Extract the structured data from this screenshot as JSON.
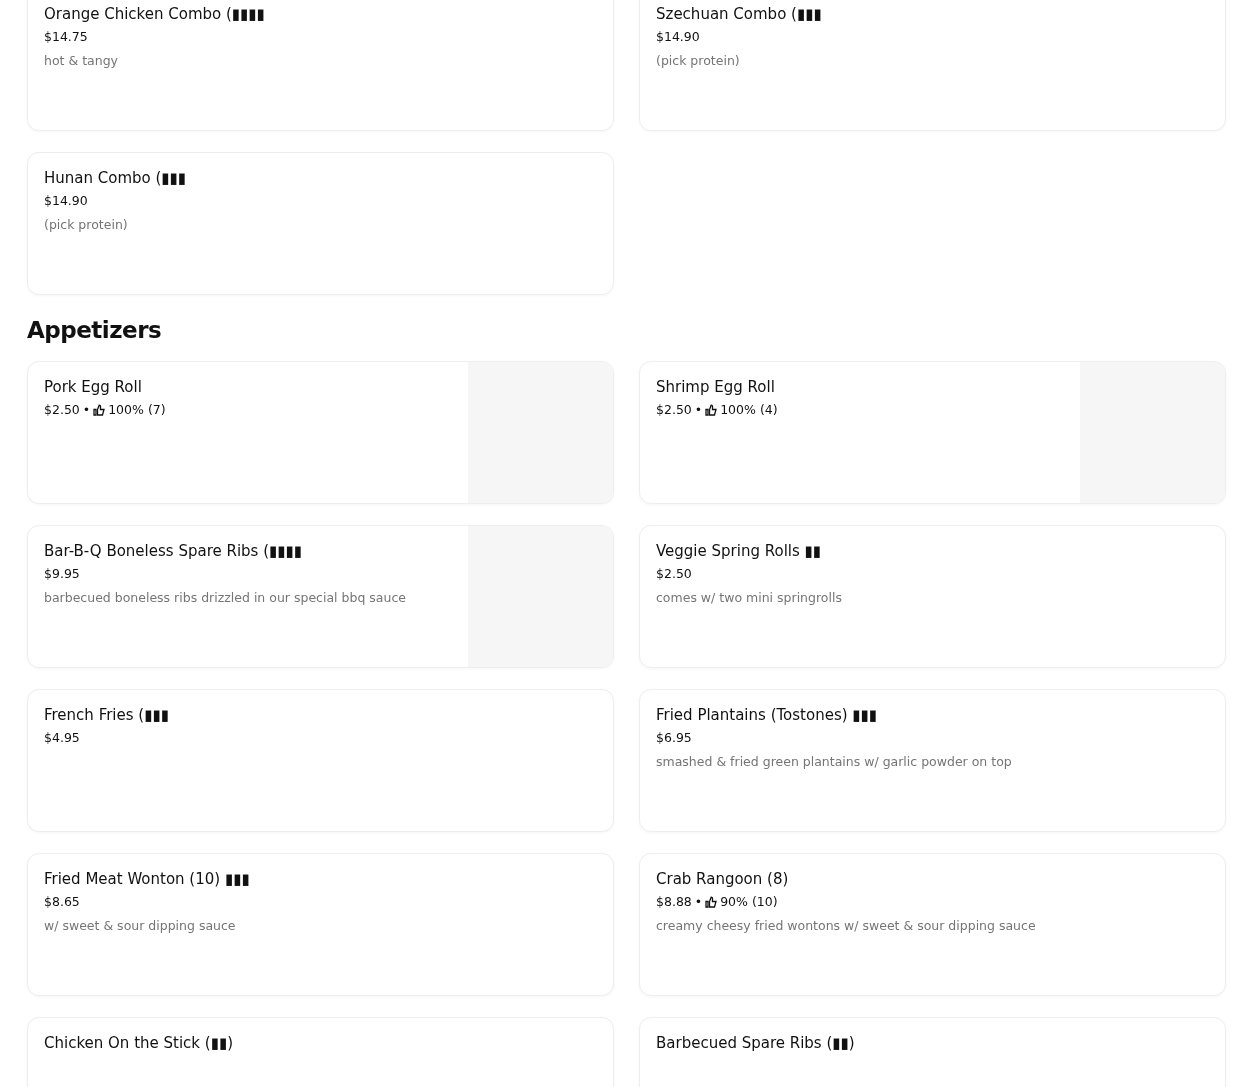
{
  "sections": [
    {
      "items": [
        {
          "kind": "plain",
          "name": "Orange Chicken Combo (▮▮▮▮",
          "price": "$14.75",
          "description": "hot & tangy"
        },
        {
          "kind": "plain",
          "name": "Szechuan Combo (▮▮▮",
          "price": "$14.90",
          "description": "(pick protein)"
        },
        {
          "kind": "plain",
          "name": "Hunan Combo (▮▮▮",
          "price": "$14.90",
          "description": "(pick protein)"
        }
      ]
    },
    {
      "title": "Appetizers",
      "items": [
        {
          "kind": "image",
          "name": "Pork Egg Roll",
          "price": "$2.50",
          "separator": "•",
          "rating": "100% (7)"
        },
        {
          "kind": "image",
          "name": "Shrimp Egg Roll",
          "price": "$2.50",
          "separator": "•",
          "rating": "100% (4)"
        },
        {
          "kind": "image",
          "name": "Bar-B-Q Boneless Spare Ribs (▮▮▮▮",
          "price": "$9.95",
          "description": "barbecued boneless ribs drizzled in our special bbq sauce"
        },
        {
          "kind": "plain",
          "name": "Veggie Spring Rolls ▮▮",
          "price": "$2.50",
          "description": "comes w/ two mini springrolls"
        },
        {
          "kind": "plain",
          "name": "French Fries (▮▮▮",
          "price": "$4.95"
        },
        {
          "kind": "plain",
          "name": "Fried Plantains (Tostones) ▮▮▮",
          "price": "$6.95",
          "description": "smashed & fried green plantains w/ garlic powder on top"
        },
        {
          "kind": "plain",
          "name": "Fried Meat Wonton (10) ▮▮▮",
          "price": "$8.65",
          "description": "w/ sweet & sour dipping sauce"
        },
        {
          "kind": "plain",
          "name": "Crab Rangoon (8)",
          "price": "$8.88",
          "separator": "•",
          "rating": "90% (10)",
          "description": "creamy cheesy fried wontons w/ sweet & sour dipping sauce"
        },
        {
          "kind": "plain",
          "name": "Chicken On the Stick (▮▮)"
        },
        {
          "kind": "plain",
          "name": "Barbecued Spare Ribs (▮▮)"
        }
      ]
    }
  ]
}
